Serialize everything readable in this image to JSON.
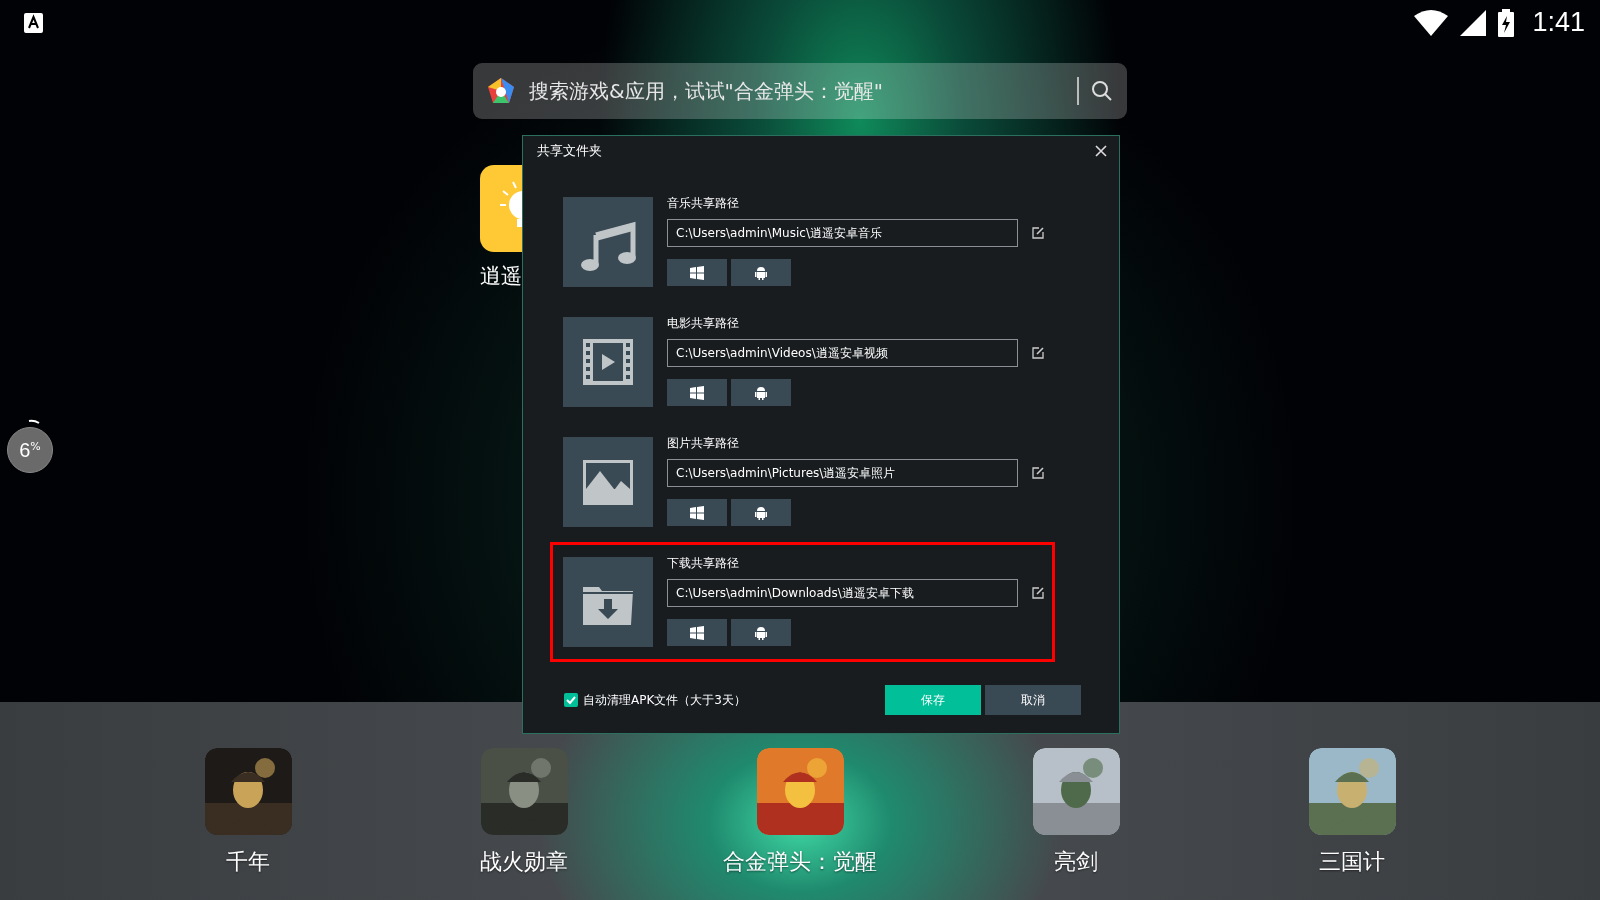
{
  "status_bar": {
    "time": "1:41"
  },
  "search": {
    "placeholder": "搜索游戏&应用，试试\"合金弹头：觉醒\""
  },
  "desktop_apps": [
    {
      "label": "逍遥"
    }
  ],
  "float_ball": {
    "value": "6",
    "unit": "%"
  },
  "dialog": {
    "title": "共享文件夹",
    "folders": [
      {
        "kind": "music",
        "label": "音乐共享路径",
        "path": "C:\\Users\\admin\\Music\\逍遥安卓音乐",
        "highlighted": false
      },
      {
        "kind": "video",
        "label": "电影共享路径",
        "path": "C:\\Users\\admin\\Videos\\逍遥安卓视频",
        "highlighted": false
      },
      {
        "label": "图片共享路径",
        "path": "C:\\Users\\admin\\Pictures\\逍遥安卓照片",
        "highlighted": false
      },
      {
        "kind": "download",
        "label": "下载共享路径",
        "path": "C:\\Users\\admin\\Downloads\\逍遥安卓下载",
        "highlighted": true
      }
    ],
    "auto_clean": {
      "label": "自动清理APK文件（大于3天）",
      "checked": true
    },
    "buttons": [
      {
        "kind": "primary",
        "label": "保存"
      },
      {
        "kind": "secondary",
        "label": "取消"
      }
    ]
  },
  "dock": [
    {
      "label": "千年"
    },
    {
      "label": "战火勋章"
    },
    {
      "label": "合金弹头：觉醒"
    },
    {
      "label": "亮剑"
    },
    {
      "label": "三国计"
    }
  ]
}
